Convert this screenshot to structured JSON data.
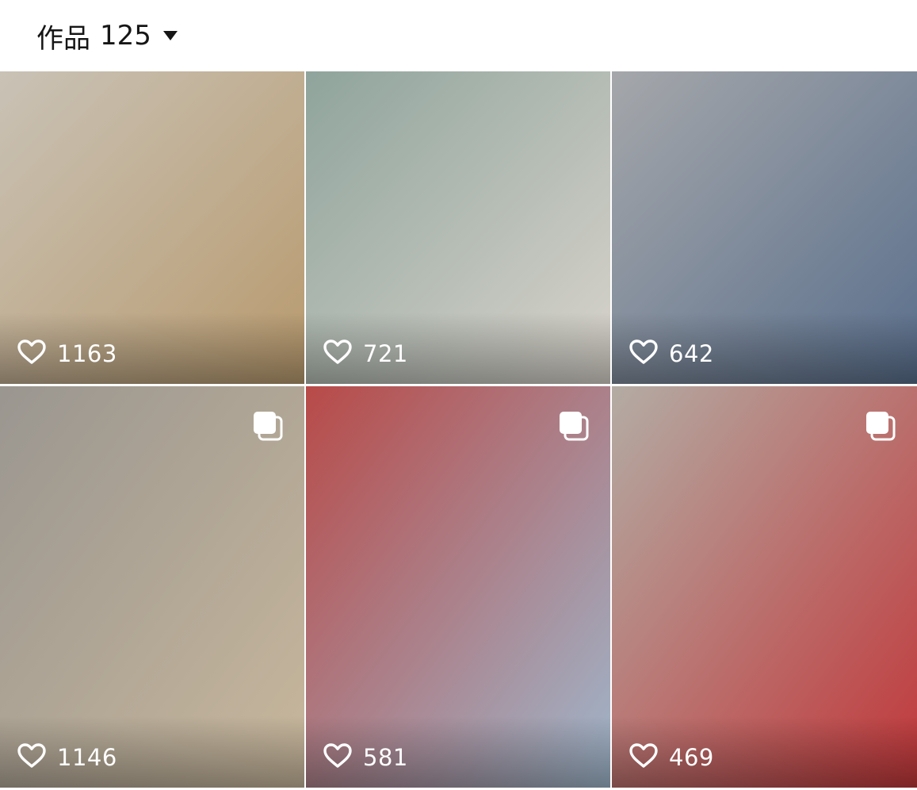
{
  "header": {
    "tab_label": "作品",
    "count": "125",
    "dropdown_icon": "caret-down-icon"
  },
  "grid": {
    "like_icon": "heart-outline-icon",
    "multi_image_icon": "multi-image-icon",
    "tiles": [
      {
        "likes": "1163",
        "multi": false,
        "bg": "#c9c2b6",
        "accent": "#b89a6e"
      },
      {
        "likes": "721",
        "multi": false,
        "bg": "#8fa49c",
        "accent": "#d9d4cc"
      },
      {
        "likes": "642",
        "multi": false,
        "bg": "#a5a7aa",
        "accent": "#5a6f8c"
      },
      {
        "likes": "1146",
        "multi": true,
        "bg": "#9a9690",
        "accent": "#c8b79c"
      },
      {
        "likes": "581",
        "multi": true,
        "bg": "#b84a48",
        "accent": "#9fb7cc"
      },
      {
        "likes": "469",
        "multi": true,
        "bg": "#b3aca4",
        "accent": "#c1373a"
      }
    ]
  }
}
